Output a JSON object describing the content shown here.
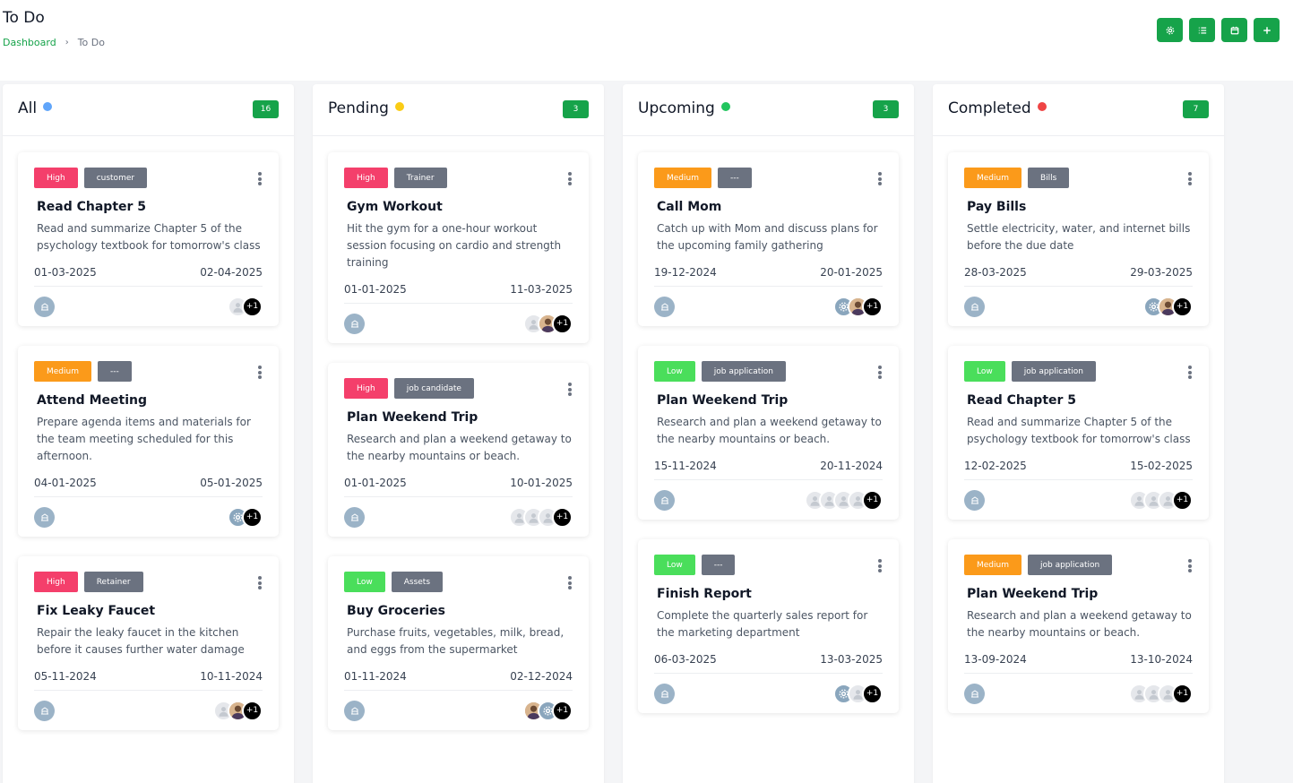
{
  "header": {
    "title": "To Do",
    "breadcrumb": {
      "home": "Dashboard",
      "separator": "›",
      "current": "To Do"
    },
    "actions": [
      {
        "icon": "settings-icon",
        "name": "settings-button"
      },
      {
        "icon": "list-view-icon",
        "name": "list-view-button"
      },
      {
        "icon": "calendar-icon",
        "name": "calendar-view-button"
      },
      {
        "icon": "plus-icon",
        "name": "add-task-button"
      }
    ]
  },
  "colors": {
    "accent": "#16a34a",
    "dot_all": "#60a5fa",
    "dot_pending": "#facc15",
    "dot_upcoming": "#22c55e",
    "dot_completed": "#ef4444",
    "priority_high": "#f43f6b",
    "priority_medium": "#fb9a1a",
    "priority_low": "#4ade5b",
    "category": "#6b7280"
  },
  "columns": [
    {
      "key": "all",
      "title": "All",
      "count": "16",
      "dot": "#60a5fa",
      "cards": [
        {
          "priority": "High",
          "prio": "high",
          "category": "customer",
          "title": "Read Chapter 5",
          "desc": "Read and summarize Chapter 5 of the psychology textbook for tomorrow's class",
          "start": "01-03-2025",
          "end": "02-04-2025",
          "avatars": [
            "person"
          ],
          "more": "+1"
        },
        {
          "priority": "Medium",
          "prio": "medium",
          "category": "---",
          "title": "Attend Meeting",
          "desc": "Prepare agenda items and materials for the team meeting scheduled for this afternoon.",
          "start": "04-01-2025",
          "end": "05-01-2025",
          "avatars": [
            "gear"
          ],
          "more": "+1"
        },
        {
          "priority": "High",
          "prio": "high",
          "category": "Retainer",
          "title": "Fix Leaky Faucet",
          "desc": "Repair the leaky faucet in the kitchen before it causes further water damage",
          "start": "05-11-2024",
          "end": "10-11-2024",
          "avatars": [
            "person",
            "photo"
          ],
          "more": "+1"
        }
      ]
    },
    {
      "key": "pending",
      "title": "Pending",
      "count": "3",
      "dot": "#facc15",
      "cards": [
        {
          "priority": "High",
          "prio": "high",
          "category": "Trainer",
          "title": "Gym Workout",
          "desc": "Hit the gym for a one-hour workout session focusing on cardio and strength training",
          "start": "01-01-2025",
          "end": "11-03-2025",
          "avatars": [
            "person",
            "photo"
          ],
          "more": "+1"
        },
        {
          "priority": "High",
          "prio": "high",
          "category": "job candidate",
          "title": "Plan Weekend Trip",
          "desc": "Research and plan a weekend getaway to the nearby mountains or beach.",
          "start": "01-01-2025",
          "end": "10-01-2025",
          "avatars": [
            "person",
            "person",
            "person"
          ],
          "more": "+1"
        },
        {
          "priority": "Low",
          "prio": "low",
          "category": "Assets",
          "title": "Buy Groceries",
          "desc": "Purchase fruits, vegetables, milk, bread, and eggs from the supermarket",
          "start": "01-11-2024",
          "end": "02-12-2024",
          "avatars": [
            "photo",
            "gear"
          ],
          "more": "+1"
        }
      ]
    },
    {
      "key": "upcoming",
      "title": "Upcoming",
      "count": "3",
      "dot": "#22c55e",
      "cards": [
        {
          "priority": "Medium",
          "prio": "medium",
          "category": "---",
          "title": "Call Mom",
          "desc": "Catch up with Mom and discuss plans for the upcoming family gathering",
          "start": "19-12-2024",
          "end": "20-01-2025",
          "avatars": [
            "gear",
            "photo"
          ],
          "more": "+1"
        },
        {
          "priority": "Low",
          "prio": "low",
          "category": "job application",
          "title": "Plan Weekend Trip",
          "desc": "Research and plan a weekend getaway to the nearby mountains or beach.",
          "start": "15-11-2024",
          "end": "20-11-2024",
          "avatars": [
            "person",
            "person",
            "person",
            "person"
          ],
          "more": "+1"
        },
        {
          "priority": "Low",
          "prio": "low",
          "category": "---",
          "title": "Finish Report",
          "desc": "Complete the quarterly sales report for the marketing department",
          "start": "06-03-2025",
          "end": "13-03-2025",
          "avatars": [
            "gear",
            "person"
          ],
          "more": "+1"
        }
      ]
    },
    {
      "key": "completed",
      "title": "Completed",
      "count": "7",
      "dot": "#ef4444",
      "cards": [
        {
          "priority": "Medium",
          "prio": "medium",
          "category": "Bills",
          "title": "Pay Bills",
          "desc": "Settle electricity, water, and internet bills before the due date",
          "start": "28-03-2025",
          "end": "29-03-2025",
          "avatars": [
            "gear",
            "photo"
          ],
          "more": "+1"
        },
        {
          "priority": "Low",
          "prio": "low",
          "category": "job application",
          "title": "Read Chapter 5",
          "desc": "Read and summarize Chapter 5 of the psychology textbook for tomorrow's class",
          "start": "12-02-2025",
          "end": "15-02-2025",
          "avatars": [
            "person",
            "person",
            "person"
          ],
          "more": "+1"
        },
        {
          "priority": "Medium",
          "prio": "medium",
          "category": "job application",
          "title": "Plan Weekend Trip",
          "desc": "Research and plan a weekend getaway to the nearby mountains or beach.",
          "start": "13-09-2024",
          "end": "13-10-2024",
          "avatars": [
            "person",
            "person",
            "person"
          ],
          "more": "+1"
        }
      ]
    }
  ]
}
